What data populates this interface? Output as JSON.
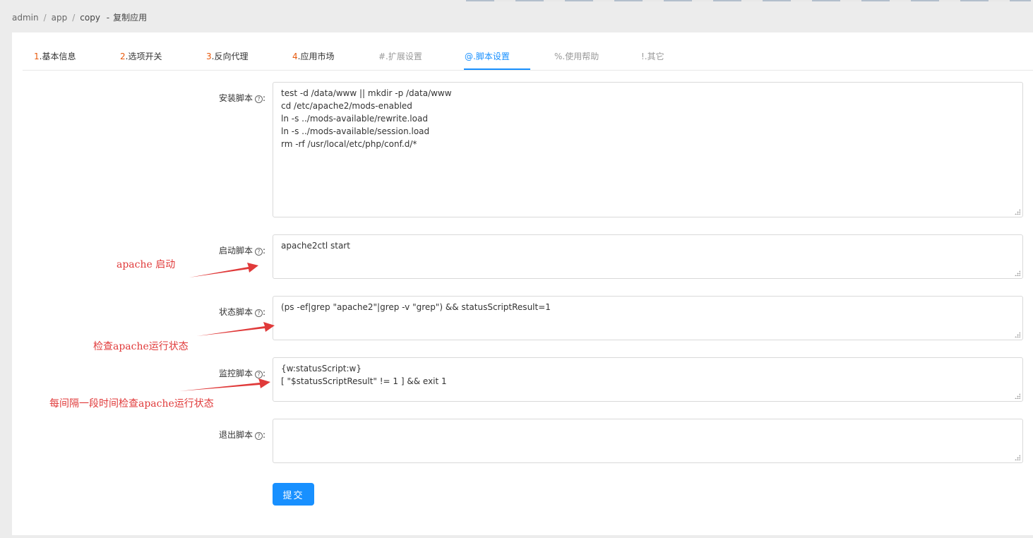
{
  "breadcrumb": {
    "items": [
      "admin",
      "app",
      "copy"
    ],
    "separator": "/",
    "dash": "-",
    "current": "复制应用"
  },
  "tabs": [
    {
      "num": "1",
      "label": ".基本信息"
    },
    {
      "num": "2",
      "label": ".选项开关"
    },
    {
      "num": "3",
      "label": ".反向代理"
    },
    {
      "num": "4",
      "label": ".应用市场"
    },
    {
      "label": "#.扩展设置"
    },
    {
      "label": "@.脚本设置"
    },
    {
      "label": "%.使用帮助"
    },
    {
      "label": "!.其它"
    }
  ],
  "active_tab": "@.脚本设置",
  "form": {
    "install": {
      "label": "安装脚本",
      "value": "test -d /data/www || mkdir -p /data/www\ncd /etc/apache2/mods-enabled\nln -s ../mods-available/rewrite.load\nln -s ../mods-available/session.load\nrm -rf /usr/local/etc/php/conf.d/*"
    },
    "start": {
      "label": "启动脚本",
      "value": "apache2ctl start"
    },
    "status": {
      "label": "状态脚本",
      "value": "(ps -ef|grep \"apache2\"|grep -v \"grep\") && statusScriptResult=1"
    },
    "monitor": {
      "label": "监控脚本",
      "value": "{w:statusScript:w}\n[ \"$statusScriptResult\" != 1 ] && exit 1"
    },
    "exit": {
      "label": "退出脚本",
      "value": ""
    },
    "label_suffix": ":",
    "help_glyph": "?"
  },
  "submit_label": "提交",
  "annotations": {
    "start": "apache  启动",
    "status": "检查apache运行状态",
    "monitor": "每间隔一段时间检查apache运行状态"
  },
  "colors": {
    "accent": "#1890ff",
    "tab_number": "#e8590c",
    "annotation": "#e03a3a"
  }
}
